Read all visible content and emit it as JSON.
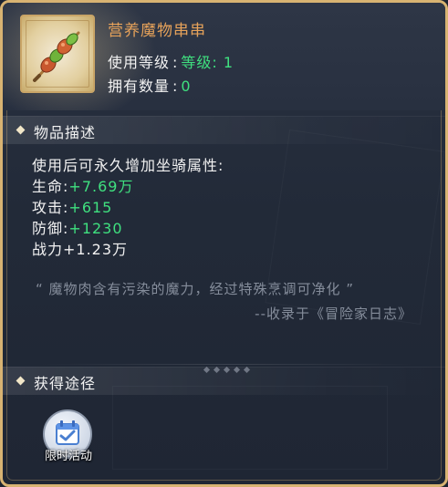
{
  "item": {
    "name": "营养魔物串串",
    "level_label": "使用等级",
    "level_value": "等级: 1",
    "owned_label": "拥有数量",
    "owned_value": "0",
    "separator": ":",
    "icon": "meat-skewer-icon"
  },
  "description": {
    "section_title": "物品描述",
    "intro": "使用后可永久增加坐骑属性:",
    "stats": [
      {
        "label": "生命:",
        "value": "+7.69万"
      },
      {
        "label": "攻击:",
        "value": "+615"
      },
      {
        "label": "防御:",
        "value": "+1230"
      }
    ],
    "power": "战力+1.23万",
    "flavor_quote": "“ 魔物肉含有污染的魔力，经过特殊烹调可净化 ”",
    "flavor_source": "--收录于《冒险家日志》"
  },
  "obtain": {
    "section_title": "获得途径",
    "sources": [
      {
        "label": "限时活动",
        "icon": "calendar-icon"
      }
    ]
  },
  "colors": {
    "title": "#e6a25a",
    "highlight": "#3fe07f",
    "border": "#d8b372",
    "muted": "#858d9b"
  }
}
